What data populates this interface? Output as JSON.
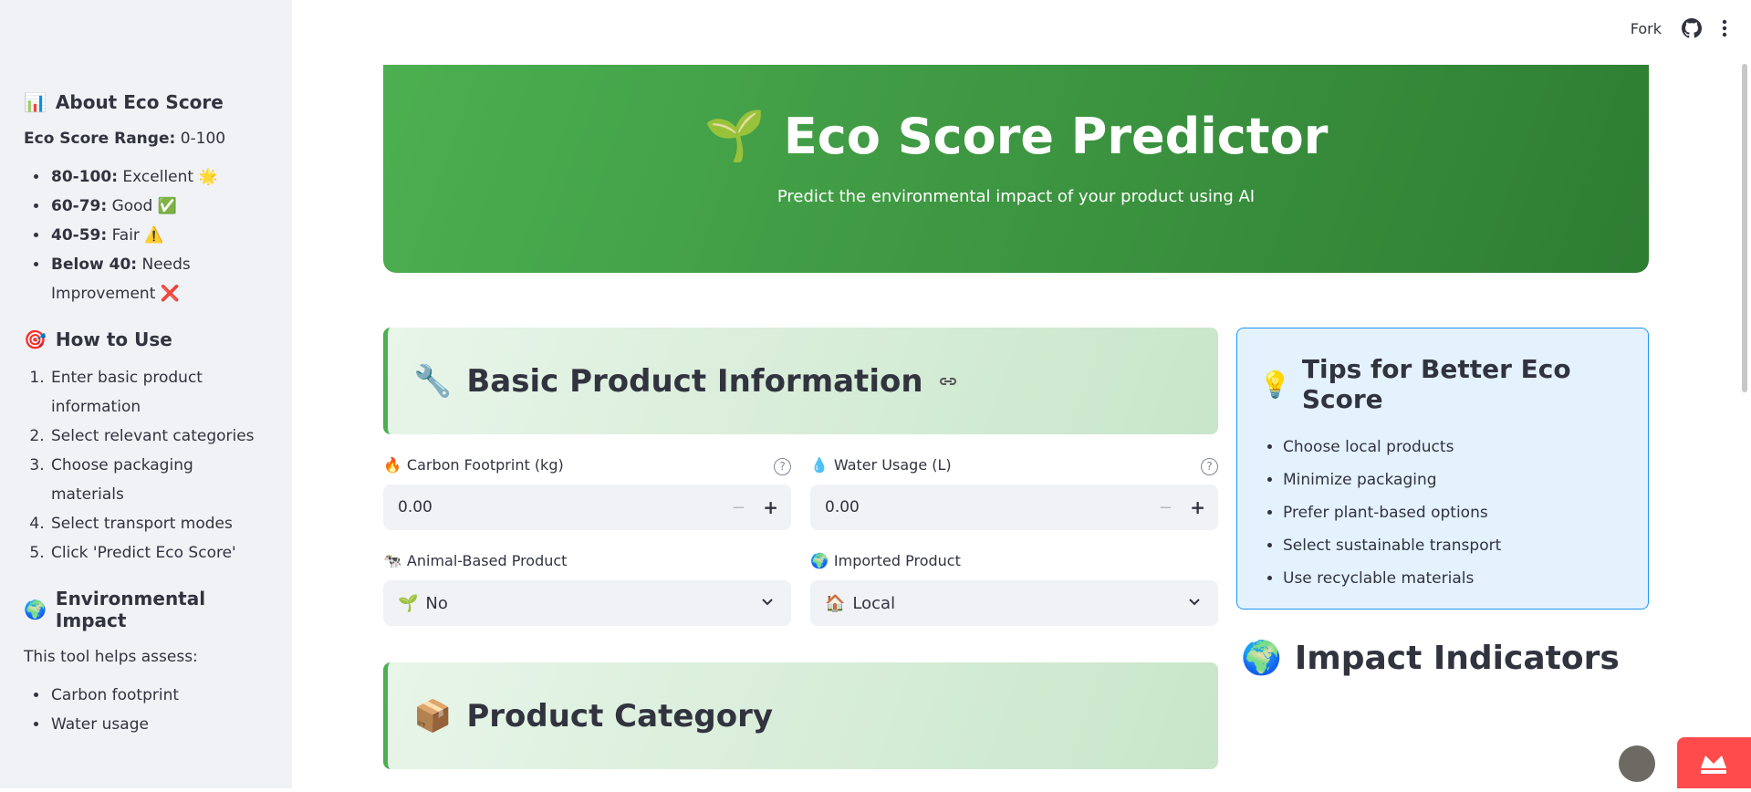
{
  "topbar": {
    "fork": "Fork"
  },
  "sidebar": {
    "about": {
      "icon": "📊",
      "title": "About Eco Score",
      "range_label": "Eco Score Range:",
      "range_value": "0-100",
      "items": [
        {
          "bold": "80-100:",
          "text": "Excellent 🌟"
        },
        {
          "bold": "60-79:",
          "text": "Good ✅"
        },
        {
          "bold": "40-59:",
          "text": "Fair ⚠️"
        },
        {
          "bold": "Below 40:",
          "text": "Needs Improvement ❌"
        }
      ]
    },
    "how": {
      "icon": "🎯",
      "title": "How to Use",
      "steps": [
        "Enter basic product information",
        "Select relevant categories",
        "Choose packaging materials",
        "Select transport modes",
        "Click 'Predict Eco Score'"
      ]
    },
    "env": {
      "icon": "🌍",
      "title": "Environmental Impact",
      "text": "This tool helps assess:",
      "items": [
        "Carbon footprint",
        "Water usage"
      ]
    }
  },
  "hero": {
    "icon": "🌱",
    "title": "Eco Score Predictor",
    "subtitle": "Predict the environmental impact of your product using AI"
  },
  "basic": {
    "icon": "🔧",
    "title": "Basic Product Information"
  },
  "carbon": {
    "icon": "🔥",
    "label": "Carbon Footprint (kg)",
    "value": "0.00"
  },
  "water": {
    "icon": "💧",
    "label": "Water Usage (L)",
    "value": "0.00"
  },
  "animal": {
    "icon": "🐄",
    "label": "Animal-Based Product",
    "value_icon": "🌱",
    "value": "No"
  },
  "imported": {
    "icon": "🌍",
    "label": "Imported Product",
    "value_icon": "🏠",
    "value": "Local"
  },
  "category": {
    "icon": "📦",
    "title": "Product Category"
  },
  "tips": {
    "icon": "💡",
    "title": "Tips for Better Eco Score",
    "items": [
      "Choose local products",
      "Minimize packaging",
      "Prefer plant-based options",
      "Select sustainable transport",
      "Use recyclable materials"
    ]
  },
  "impact": {
    "icon": "🌍",
    "title": "Impact Indicators"
  },
  "help_glyph": "?",
  "colors": {
    "hero_start": "#4caf50",
    "hero_end": "#2e7d32",
    "panel_border": "#4caf50",
    "tips_border": "#2196f3",
    "accent_red": "#ff4b4b"
  }
}
